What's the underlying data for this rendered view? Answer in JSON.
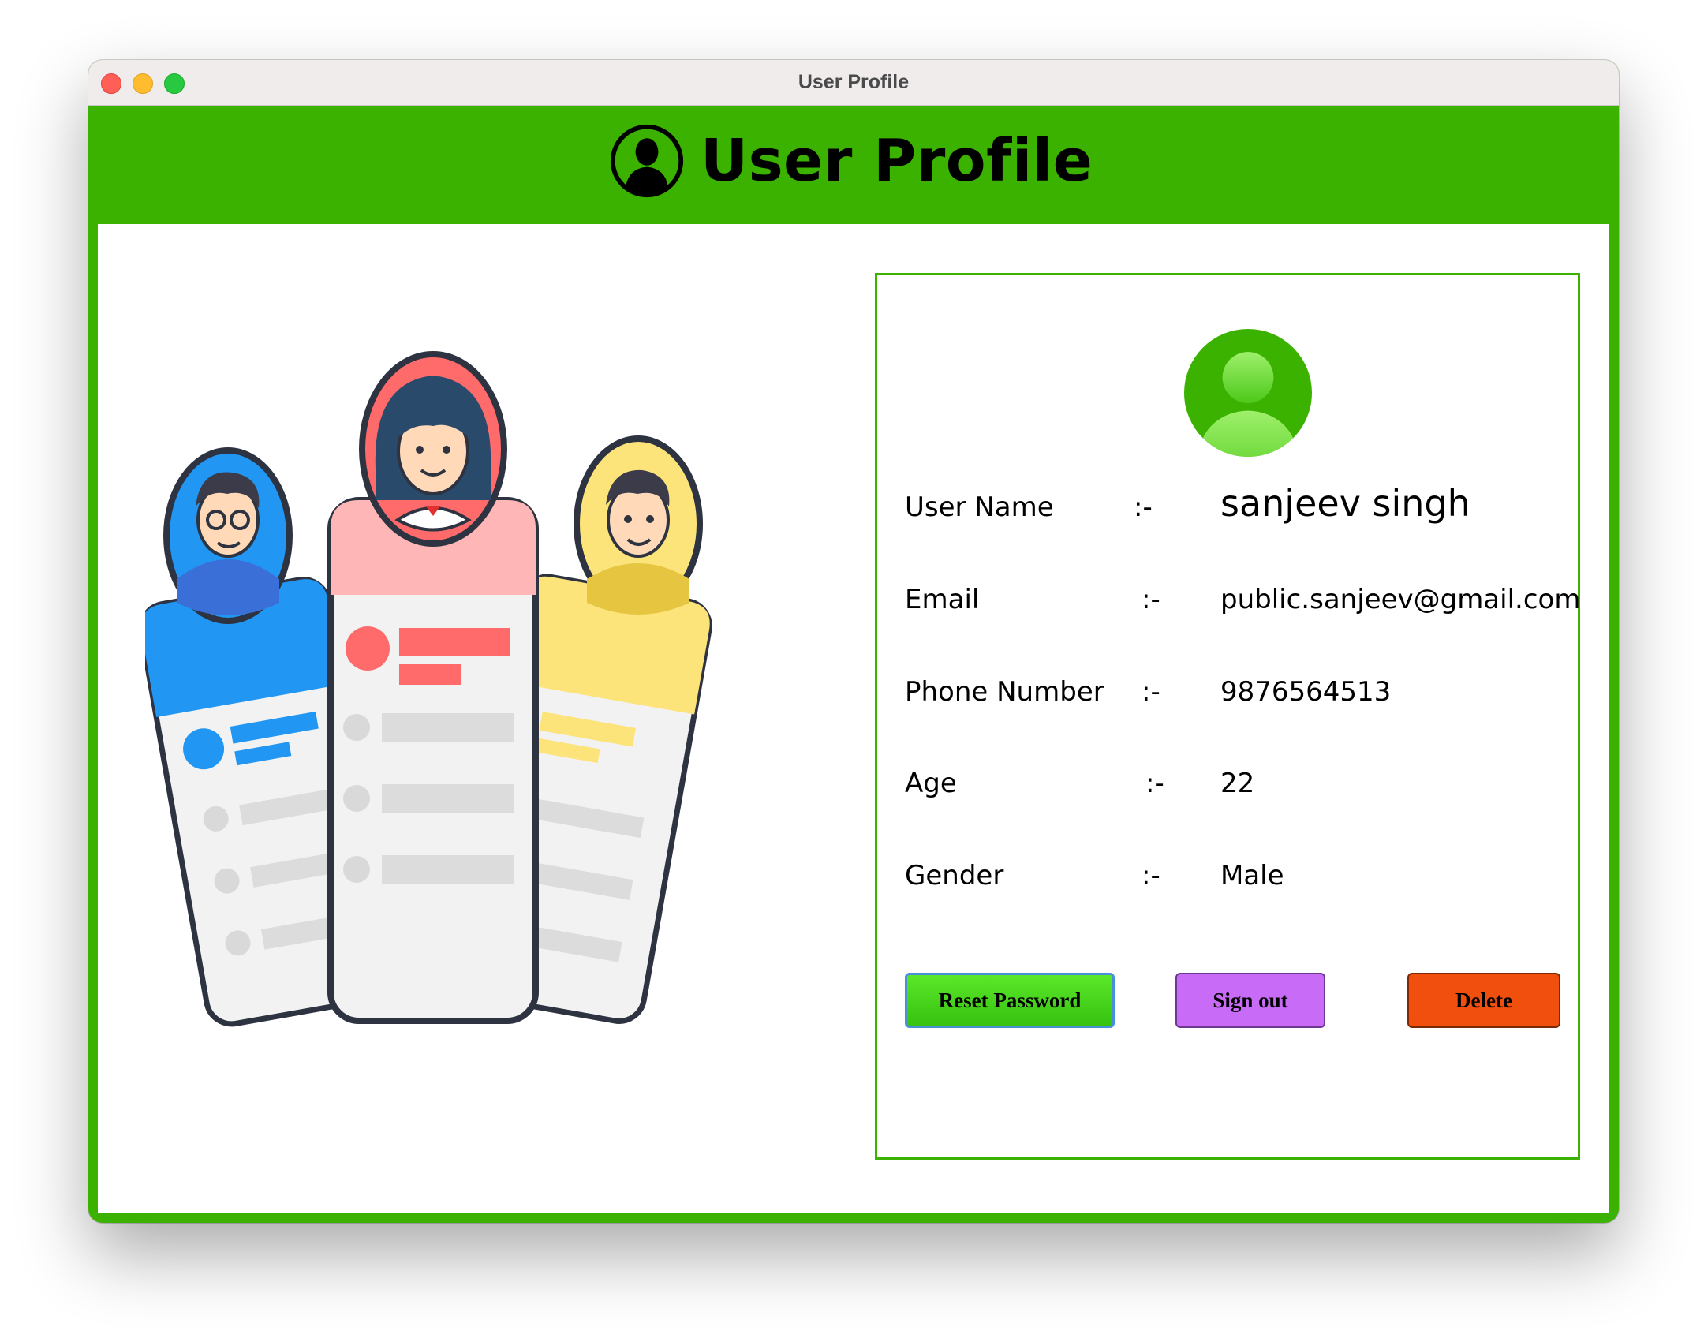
{
  "window": {
    "title": "User Profile",
    "controls": [
      "close",
      "minimize",
      "maximize"
    ]
  },
  "header": {
    "title": "User Profile",
    "icon": "user-silhouette-icon",
    "background_color": "#3bb200"
  },
  "illustration": {
    "icon": "profile-cards-illustration"
  },
  "profile": {
    "avatar_icon": "user-avatar-icon",
    "fields": [
      {
        "label": "User Name",
        "separator": ":-",
        "value": "sanjeev singh"
      },
      {
        "label": "Email",
        "separator": ":-",
        "value": "public.sanjeev@gmail.com"
      },
      {
        "label": "Phone Number",
        "separator": ":-",
        "value": "9876564513"
      },
      {
        "label": "Age",
        "separator": ":-",
        "value": "22"
      },
      {
        "label": "Gender",
        "separator": ":-",
        "value": "Male"
      }
    ]
  },
  "actions": {
    "reset_password": "Reset Password",
    "sign_out": "Sign out",
    "delete": "Delete"
  },
  "colors": {
    "accent": "#3bb200",
    "reset_button": "#4fe01f",
    "signout_button": "#c86bf7",
    "delete_button": "#f04f0d"
  }
}
